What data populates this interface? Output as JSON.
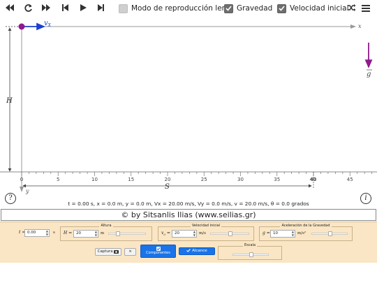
{
  "toolbar": {
    "slow_motion_label": "Modo de reproducción lenta",
    "slow_motion_checked": false,
    "gravity_label": "Gravedad",
    "gravity_checked": true,
    "initial_velocity_label": "Velocidad inicial",
    "initial_velocity_checked": true,
    "buttons": [
      "rewind-icon",
      "reload-icon",
      "fast-forward-icon",
      "skip-back-icon",
      "play-icon",
      "skip-forward-icon",
      "shuffle-icon",
      "menu-icon"
    ]
  },
  "canvas": {
    "velocity_label": "v",
    "velocity_sub": "X",
    "x_axis_label": "x",
    "y_axis_label": "y",
    "height_label": "H",
    "range_label": "S",
    "gravity_label": "g",
    "x_ticks": [
      "0",
      "5",
      "10",
      "15",
      "20",
      "25",
      "30",
      "35",
      "40",
      "45"
    ],
    "range_marker": "40",
    "colors": {
      "ball": "#8e1a8e",
      "velocity_vector": "#1a3fd1",
      "gravity_vector": "#8e1a8e",
      "axis": "#999999"
    }
  },
  "status": {
    "text": "t = 0.00 s, x = 0.0 m, y = 0.0 m, Vx = 20.00 m/s, Vy = 0.0 m/s, v = 20.0 m/s, θ = 0.0 grados"
  },
  "credit": {
    "text": "© by Sitsanlis Ilias (www.seilias.gr)"
  },
  "help_button": {
    "label": "?"
  },
  "info_button": {
    "label": "i"
  },
  "controls": {
    "time": {
      "label": "t =",
      "value": "0.00",
      "unit": "s"
    },
    "height": {
      "title": "Altura",
      "label": "H =",
      "value": "20",
      "unit": "m",
      "slider_fraction": 0.2
    },
    "velocity": {
      "title": "Velocidad inicial",
      "label": "v",
      "label_sub": "0",
      "label_suffix": " =",
      "value": "20",
      "unit": "m/s",
      "slider_fraction": 0.5
    },
    "gravity": {
      "title": "Aceleración de la Gravedad",
      "label": "g =",
      "value": "10",
      "unit": "m/s²",
      "slider_fraction": 0.5
    },
    "scale": {
      "title": "Escala",
      "slider_fraction": 0.5
    },
    "capture_button": "Captura",
    "close_button": "×",
    "components_button": "Componentes",
    "range_button": "Alcance"
  }
}
